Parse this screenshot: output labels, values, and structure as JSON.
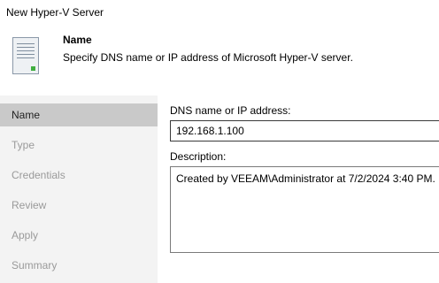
{
  "window": {
    "title": "New Hyper-V Server"
  },
  "header": {
    "icon": "server-icon",
    "title": "Name",
    "subtitle": "Specify DNS name or IP address of Microsoft Hyper-V server."
  },
  "sidebar": {
    "active_index": 0,
    "items": [
      {
        "label": "Name"
      },
      {
        "label": "Type"
      },
      {
        "label": "Credentials"
      },
      {
        "label": "Review"
      },
      {
        "label": "Apply"
      },
      {
        "label": "Summary"
      }
    ]
  },
  "form": {
    "dns_label": "DNS name or IP address:",
    "dns_value": "192.168.1.100",
    "description_label": "Description:",
    "description_value": "Created by VEEAM\\Administrator at 7/2/2024 3:40 PM."
  },
  "colors": {
    "sidebar_bg": "#f3f3f3",
    "sidebar_active_bg": "#c9c9c9",
    "inactive_step_text": "#9a9a9a"
  }
}
